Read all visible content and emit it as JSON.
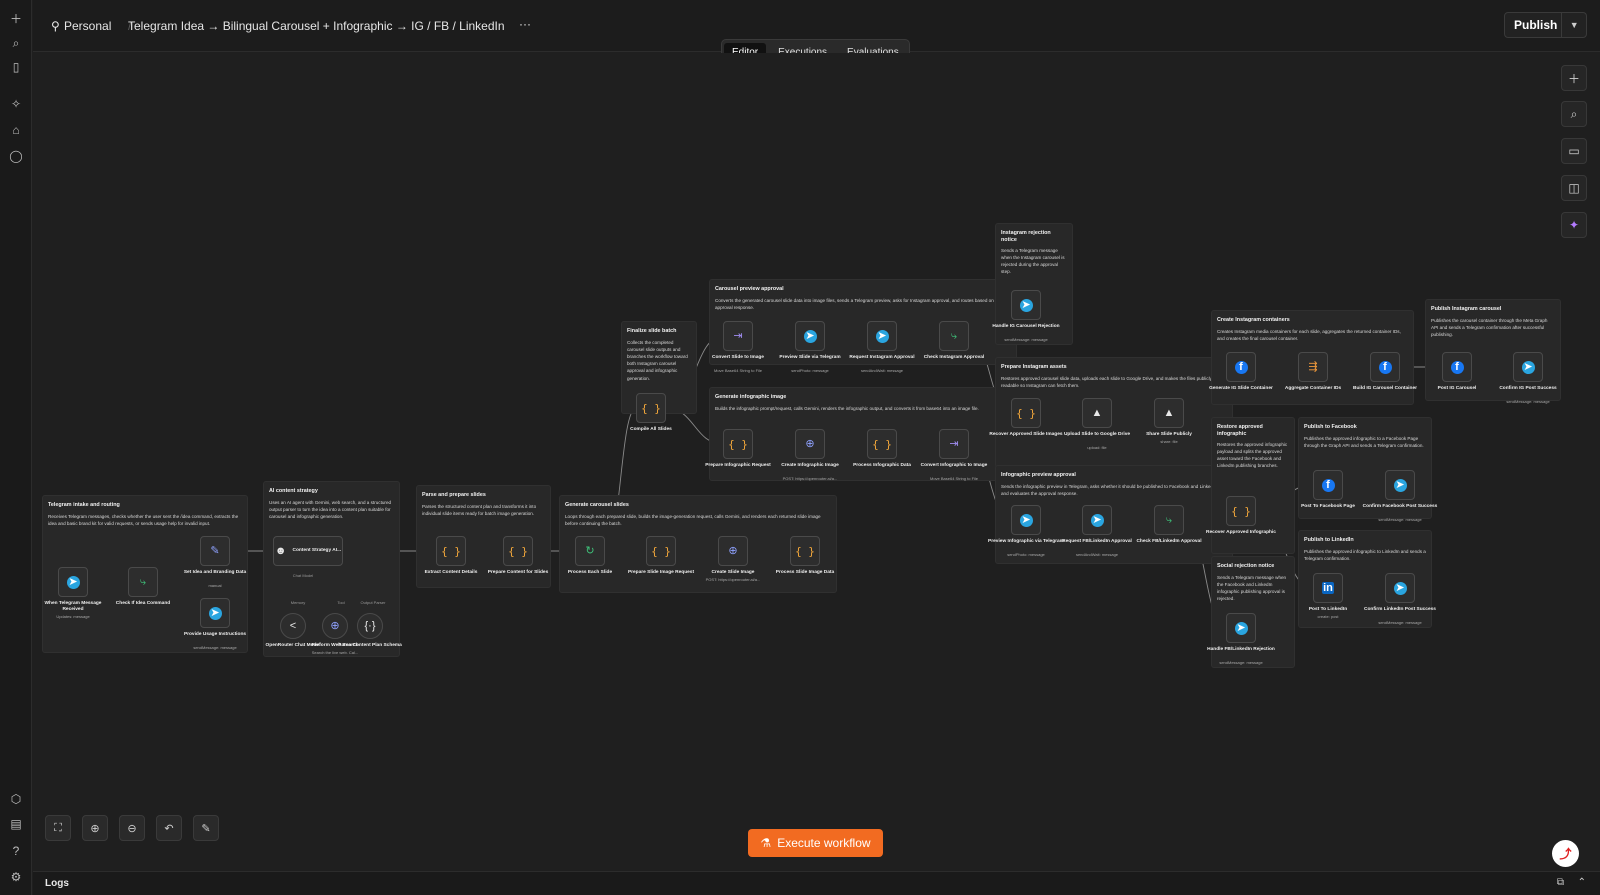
{
  "header": {
    "workspace": "Personal",
    "workflow_title": "Telegram Idea → Bilingual Carousel + Infographic → IG / FB / LinkedIn",
    "more": "···",
    "publish": "Publish"
  },
  "tabs": [
    "Editor",
    "Executions",
    "Evaluations"
  ],
  "active_tab": "Editor",
  "execute_button": "Execute workflow",
  "logs_label": "Logs",
  "sticky_notes": [
    {
      "title": "Telegram intake and routing",
      "desc": "Receives Telegram messages, checks whether the user sent the /idea command, extracts the idea and basic brand kit for valid requests, or sends usage help for invalid input."
    },
    {
      "title": "AI content strategy",
      "desc": "Uses an AI agent with Gemini, web search, and a structured output parser to turn the idea into a content plan suitable for carousel and infographic generation."
    },
    {
      "title": "Parse and prepare slides",
      "desc": "Parses the structured content plan and transforms it into individual slide items ready for batch image generation."
    },
    {
      "title": "Generate carousel slides",
      "desc": "Loops through each prepared slide, builds the image-generation request, calls Gemini, and renders each returned slide image before continuing the batch."
    },
    {
      "title": "Finalize slide batch",
      "desc": "Collects the completed carousel slide outputs and branches the workflow toward both Instagram carousel approval and infographic generation."
    },
    {
      "title": "Carousel preview approval",
      "desc": "Converts the generated carousel slide data into image files, sends a Telegram preview, asks for Instagram approval, and routes based on the approval response."
    },
    {
      "title": "Generate infographic image",
      "desc": "Builds the infographic prompt/request, calls Gemini, renders the infographic output, and converts it from base64 into an image file."
    },
    {
      "title": "Instagram rejection notice",
      "desc": "Sends a Telegram message when the Instagram carousel is rejected during the approval step."
    },
    {
      "title": "Prepare Instagram assets",
      "desc": "Restores approved carousel slide data, uploads each slide to Google Drive, and makes the files publicly readable so Instagram can fetch them."
    },
    {
      "title": "Infographic preview approval",
      "desc": "Sends the infographic preview in Telegram, asks whether it should be published to Facebook and LinkedIn, and evaluates the approval response."
    },
    {
      "title": "Create Instagram containers",
      "desc": "Creates Instagram media containers for each slide, aggregates the returned container IDs, and creates the final carousel container."
    },
    {
      "title": "Publish Instagram carousel",
      "desc": "Publishes the carousel container through the Meta Graph API and sends a Telegram confirmation after successful publishing."
    },
    {
      "title": "Restore approved infographic",
      "desc": "Restores the approved infographic payload and splits the approved asset toward the Facebook and LinkedIn publishing branches."
    },
    {
      "title": "Publish to Facebook",
      "desc": "Publishes the approved infographic to a Facebook Page through the Graph API and sends a Telegram confirmation."
    },
    {
      "title": "Publish to LinkedIn",
      "desc": "Publishes the approved infographic to LinkedIn and sends a Telegram confirmation."
    },
    {
      "title": "Social rejection notice",
      "desc": "Sends a Telegram message when the Facebook and LinkedIn infographic publishing approval is rejected."
    }
  ],
  "nodes": [
    {
      "label": "When Telegram Message Received",
      "sub": "Updates: message",
      "icon": "telegram-icon"
    },
    {
      "label": "Check If Idea Command",
      "sub": "",
      "icon": "switch-icon"
    },
    {
      "label": "Set Idea and Branding Data",
      "sub": "manual",
      "icon": "edit-icon"
    },
    {
      "label": "Provide Usage Instructions",
      "sub": "sendMessage: message",
      "icon": "telegram-icon"
    },
    {
      "label": "Content Strategy AI...",
      "sub": "",
      "icon": "robot-icon"
    },
    {
      "label": "OpenRouter Chat Model",
      "sub": "",
      "icon": "openrouter-icon"
    },
    {
      "label": "Perform Web Search",
      "sub": "Search the live web. Cal...",
      "icon": "globe-icon"
    },
    {
      "label": "Parse Content Plan Schema",
      "sub": "",
      "icon": "parser-icon"
    },
    {
      "label": "Extract Content Details",
      "sub": "",
      "icon": "code-icon"
    },
    {
      "label": "Prepare Content for Slides",
      "sub": "",
      "icon": "code-icon"
    },
    {
      "label": "Process Each Slide",
      "sub": "",
      "icon": "loop-icon"
    },
    {
      "label": "Prepare Slide Image Request",
      "sub": "",
      "icon": "code-icon"
    },
    {
      "label": "Create Slide Image",
      "sub": "POST: https://openrouter.ai/a...",
      "icon": "globe-icon"
    },
    {
      "label": "Process Slide Image Data",
      "sub": "",
      "icon": "code-icon"
    },
    {
      "label": "Compile All Slides",
      "sub": "",
      "icon": "code-icon"
    },
    {
      "label": "Convert Slide to Image",
      "sub": "Move Base64 String to File",
      "icon": "convert-icon"
    },
    {
      "label": "Preview Slide via Telegram",
      "sub": "sendPhoto: message",
      "icon": "telegram-icon"
    },
    {
      "label": "Request Instagram Approval",
      "sub": "sendAndWait: message",
      "icon": "telegram-icon"
    },
    {
      "label": "Check Instagram Approval",
      "sub": "",
      "icon": "switch-icon"
    },
    {
      "label": "Prepare Infographic Request",
      "sub": "",
      "icon": "code-icon"
    },
    {
      "label": "Create Infographic Image",
      "sub": "POST: https://openrouter.ai/a...",
      "icon": "globe-icon"
    },
    {
      "label": "Process Infographic Data",
      "sub": "",
      "icon": "code-icon"
    },
    {
      "label": "Convert Infographic to Image",
      "sub": "Move Base64 String to File",
      "icon": "convert-icon"
    },
    {
      "label": "Handle IG Carousel Rejection",
      "sub": "sendMessage: message",
      "icon": "telegram-icon"
    },
    {
      "label": "Recover Approved Slide Images",
      "sub": "",
      "icon": "code-icon"
    },
    {
      "label": "Upload Slide to Google Drive",
      "sub": "upload: file",
      "icon": "drive-icon"
    },
    {
      "label": "Share Slide Publicly",
      "sub": "share: file",
      "icon": "drive-icon"
    },
    {
      "label": "Preview Infographic via Telegram",
      "sub": "sendPhoto: message",
      "icon": "telegram-icon"
    },
    {
      "label": "Request FB/LinkedIn Approval",
      "sub": "sendAndWait: message",
      "icon": "telegram-icon"
    },
    {
      "label": "Check FB/LinkedIn Approval",
      "sub": "",
      "icon": "switch-icon"
    },
    {
      "label": "Generate IG Slide Container",
      "sub": "",
      "icon": "facebook-icon"
    },
    {
      "label": "Aggregate Container IDs",
      "sub": "",
      "icon": "aggregate-icon"
    },
    {
      "label": "Build IG Carousel Container",
      "sub": "",
      "icon": "facebook-icon"
    },
    {
      "label": "Post IG Carousel",
      "sub": "",
      "icon": "facebook-icon"
    },
    {
      "label": "Confirm IG Post Success",
      "sub": "sendMessage: message",
      "icon": "telegram-icon"
    },
    {
      "label": "Recover Approved Infographic",
      "sub": "",
      "icon": "code-icon"
    },
    {
      "label": "Post To Facebook Page",
      "sub": "",
      "icon": "facebook-icon"
    },
    {
      "label": "Confirm Facebook Post Success",
      "sub": "sendMessage: message",
      "icon": "telegram-icon"
    },
    {
      "label": "Post To LinkedIn",
      "sub": "create: post",
      "icon": "linkedin-icon"
    },
    {
      "label": "Confirm LinkedIn Post Success",
      "sub": "sendMessage: message",
      "icon": "telegram-icon"
    },
    {
      "label": "Handle FB/LinkedIn Rejection",
      "sub": "sendMessage: message",
      "icon": "telegram-icon"
    }
  ],
  "agent_ports": [
    "Chat Model",
    "Memory",
    "Tool",
    "Output Parser"
  ],
  "colors": {
    "accent": "#f26b21",
    "canvas": "#1f1f1f",
    "telegram": "#2aa5e0",
    "facebook": "#1877f2",
    "linkedin": "#0a66c2",
    "code": "#f2a73b",
    "switch": "#3fc27a"
  }
}
